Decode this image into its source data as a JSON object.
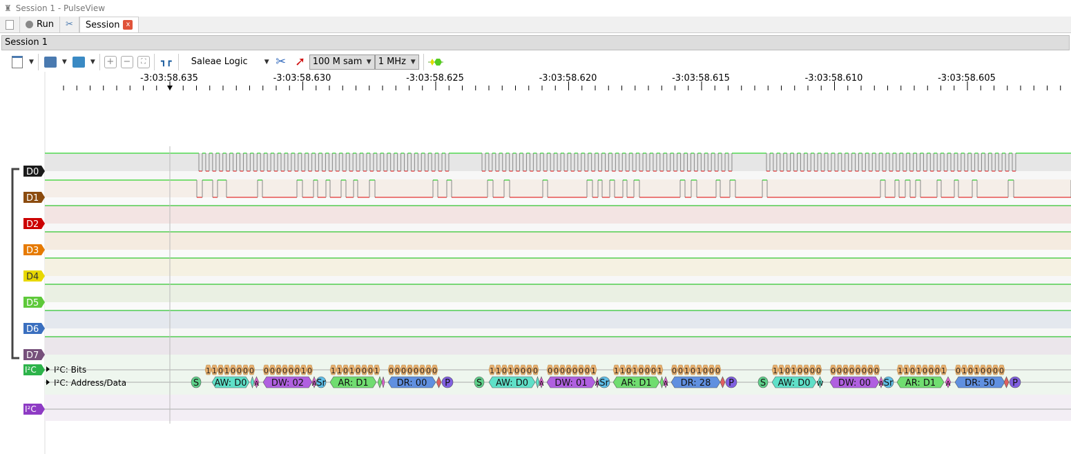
{
  "window": {
    "title": "Session 1 - PulseView"
  },
  "tabs": {
    "run": "Run",
    "session": "Session",
    "close": "x"
  },
  "session_bar": {
    "title": "Session 1"
  },
  "toolbar": {
    "device": "Saleae Logic",
    "samples": "100 M samp",
    "samplerate": "1 MHz"
  },
  "ruler": {
    "labels": [
      "-3:03:58.635",
      "-3:03:58.630",
      "-3:03:58.625",
      "-3:03:58.620",
      "-3:03:58.615",
      "-3:03:58.610",
      "-3:03:58.605"
    ]
  },
  "channels": [
    {
      "name": "D0",
      "color": "#1a1a1a",
      "bg": "#e6e6e6"
    },
    {
      "name": "D1",
      "color": "#8b4b0e",
      "bg": "#f5eee8"
    },
    {
      "name": "D2",
      "color": "#cc0000",
      "bg": "#f3e4e3"
    },
    {
      "name": "D3",
      "color": "#e67a00",
      "bg": "#f5ebe0"
    },
    {
      "name": "D4",
      "color": "#e8d800",
      "bg": "#f5f1e2"
    },
    {
      "name": "D5",
      "color": "#5ec93a",
      "bg": "#eaf0e3"
    },
    {
      "name": "D6",
      "color": "#3a6fbf",
      "bg": "#e4e8ee"
    },
    {
      "name": "D7",
      "color": "#76507b",
      "bg": "#ebe6eb"
    }
  ],
  "decoders": [
    {
      "name": "I²C",
      "color": "#2db34a",
      "rows": [
        "I²C: Bits",
        "I²C: Address/Data"
      ]
    },
    {
      "name": "I²C",
      "color": "#8e3bc4"
    }
  ],
  "annotations": [
    {
      "t": "S",
      "c": "#5fd08a"
    },
    {
      "t": "AW: D0",
      "c": "#5fe0c8"
    },
    {
      "t": "",
      "c": "#5fe0c8"
    },
    {
      "t": "A",
      "c": "#e060d0"
    },
    {
      "t": "DW: 02",
      "c": "#b060e0"
    },
    {
      "t": "A",
      "c": "#e060d0"
    },
    {
      "t": "Sr",
      "c": "#5fbfe8"
    },
    {
      "t": "AR: D1",
      "c": "#70dd70"
    },
    {
      "t": "",
      "c": "#70dd70"
    },
    {
      "t": "",
      "c": "#e060d0"
    },
    {
      "t": "DR: 00",
      "c": "#6090e0"
    },
    {
      "t": "",
      "c": "#e06060"
    },
    {
      "t": "P",
      "c": "#8060e0"
    },
    {
      "t": "S",
      "c": "#5fd08a"
    },
    {
      "t": "AW: D0",
      "c": "#5fe0c8"
    },
    {
      "t": "",
      "c": "#5fe0c8"
    },
    {
      "t": "A",
      "c": "#e060d0"
    },
    {
      "t": "DW: 01",
      "c": "#b060e0"
    },
    {
      "t": "A",
      "c": "#e060d0"
    },
    {
      "t": "Sr",
      "c": "#5fbfe8"
    },
    {
      "t": "AR: D1",
      "c": "#70dd70"
    },
    {
      "t": "",
      "c": "#70dd70"
    },
    {
      "t": "A",
      "c": "#e060d0"
    },
    {
      "t": "DR: 28",
      "c": "#6090e0"
    },
    {
      "t": "",
      "c": "#e06060"
    },
    {
      "t": "P",
      "c": "#8060e0"
    },
    {
      "t": "S",
      "c": "#5fd08a"
    },
    {
      "t": "AW: D0",
      "c": "#5fe0c8"
    },
    {
      "t": "W",
      "c": "#5fe0c8"
    },
    {
      "t": "DW: 00",
      "c": "#b060e0"
    },
    {
      "t": "A",
      "c": "#e060d0"
    },
    {
      "t": "Sr",
      "c": "#5fbfe8"
    },
    {
      "t": "AR: D1",
      "c": "#70dd70"
    },
    {
      "t": "A",
      "c": "#e060d0"
    },
    {
      "t": "DR: 50",
      "c": "#6090e0"
    },
    {
      "t": "",
      "c": "#e06060"
    },
    {
      "t": "P",
      "c": "#8060e0"
    }
  ],
  "bit_groups": [
    "11010000",
    "00000010",
    "11010001",
    "00000000",
    "11010000",
    "00000001",
    "11010001",
    "00101000",
    "11010000",
    "00000000",
    "11010001",
    "01010000"
  ]
}
